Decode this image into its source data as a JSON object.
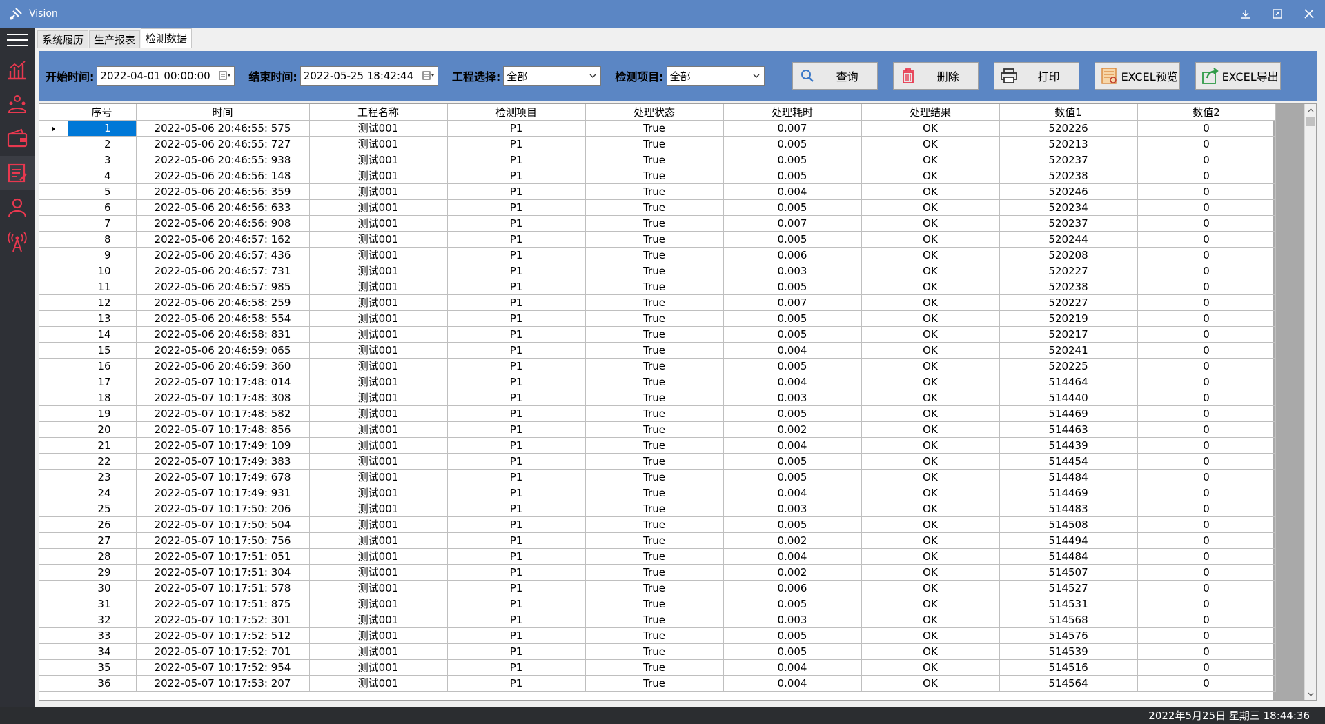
{
  "window": {
    "title": "Vision"
  },
  "tabs": [
    {
      "label": "系统履历",
      "active": false
    },
    {
      "label": "生产报表",
      "active": false
    },
    {
      "label": "检测数据",
      "active": true
    }
  ],
  "nav_icons": [
    "chart-icon",
    "users-icon",
    "wallet-icon",
    "report-icon",
    "person-icon",
    "antenna-icon"
  ],
  "toolbar": {
    "start_label": "开始时间:",
    "start_value": "2022-04-01 00:00:00",
    "end_label": "结束时间:",
    "end_value": "2022-05-25 18:42:44",
    "project_label": "工程选择:",
    "project_value": "全部",
    "item_label": "检测项目:",
    "item_value": "全部",
    "query_label": "查询",
    "delete_label": "删除",
    "print_label": "打印",
    "excel_preview_label": "EXCEL预览",
    "excel_export_label": "EXCEL导出"
  },
  "grid": {
    "columns": [
      "序号",
      "时间",
      "工程名称",
      "检测项目",
      "处理状态",
      "处理耗时",
      "处理结果",
      "数值1",
      "数值2"
    ],
    "rows": [
      [
        "1",
        "2022-05-06 20:46:55: 575",
        "测试001",
        "P1",
        "True",
        "0.007",
        "OK",
        "520226",
        "0"
      ],
      [
        "2",
        "2022-05-06 20:46:55: 727",
        "测试001",
        "P1",
        "True",
        "0.005",
        "OK",
        "520213",
        "0"
      ],
      [
        "3",
        "2022-05-06 20:46:55: 938",
        "测试001",
        "P1",
        "True",
        "0.005",
        "OK",
        "520237",
        "0"
      ],
      [
        "4",
        "2022-05-06 20:46:56: 148",
        "测试001",
        "P1",
        "True",
        "0.005",
        "OK",
        "520238",
        "0"
      ],
      [
        "5",
        "2022-05-06 20:46:56: 359",
        "测试001",
        "P1",
        "True",
        "0.004",
        "OK",
        "520246",
        "0"
      ],
      [
        "6",
        "2022-05-06 20:46:56: 633",
        "测试001",
        "P1",
        "True",
        "0.005",
        "OK",
        "520234",
        "0"
      ],
      [
        "7",
        "2022-05-06 20:46:56: 908",
        "测试001",
        "P1",
        "True",
        "0.007",
        "OK",
        "520237",
        "0"
      ],
      [
        "8",
        "2022-05-06 20:46:57: 162",
        "测试001",
        "P1",
        "True",
        "0.005",
        "OK",
        "520244",
        "0"
      ],
      [
        "9",
        "2022-05-06 20:46:57: 436",
        "测试001",
        "P1",
        "True",
        "0.006",
        "OK",
        "520208",
        "0"
      ],
      [
        "10",
        "2022-05-06 20:46:57: 731",
        "测试001",
        "P1",
        "True",
        "0.003",
        "OK",
        "520227",
        "0"
      ],
      [
        "11",
        "2022-05-06 20:46:57: 985",
        "测试001",
        "P1",
        "True",
        "0.005",
        "OK",
        "520238",
        "0"
      ],
      [
        "12",
        "2022-05-06 20:46:58: 259",
        "测试001",
        "P1",
        "True",
        "0.007",
        "OK",
        "520227",
        "0"
      ],
      [
        "13",
        "2022-05-06 20:46:58: 554",
        "测试001",
        "P1",
        "True",
        "0.005",
        "OK",
        "520219",
        "0"
      ],
      [
        "14",
        "2022-05-06 20:46:58: 831",
        "测试001",
        "P1",
        "True",
        "0.005",
        "OK",
        "520217",
        "0"
      ],
      [
        "15",
        "2022-05-06 20:46:59: 065",
        "测试001",
        "P1",
        "True",
        "0.004",
        "OK",
        "520241",
        "0"
      ],
      [
        "16",
        "2022-05-06 20:46:59: 360",
        "测试001",
        "P1",
        "True",
        "0.005",
        "OK",
        "520225",
        "0"
      ],
      [
        "17",
        "2022-05-07 10:17:48: 014",
        "测试001",
        "P1",
        "True",
        "0.004",
        "OK",
        "514464",
        "0"
      ],
      [
        "18",
        "2022-05-07 10:17:48: 308",
        "测试001",
        "P1",
        "True",
        "0.003",
        "OK",
        "514440",
        "0"
      ],
      [
        "19",
        "2022-05-07 10:17:48: 582",
        "测试001",
        "P1",
        "True",
        "0.005",
        "OK",
        "514469",
        "0"
      ],
      [
        "20",
        "2022-05-07 10:17:48: 856",
        "测试001",
        "P1",
        "True",
        "0.002",
        "OK",
        "514463",
        "0"
      ],
      [
        "21",
        "2022-05-07 10:17:49: 109",
        "测试001",
        "P1",
        "True",
        "0.004",
        "OK",
        "514439",
        "0"
      ],
      [
        "22",
        "2022-05-07 10:17:49: 383",
        "测试001",
        "P1",
        "True",
        "0.005",
        "OK",
        "514454",
        "0"
      ],
      [
        "23",
        "2022-05-07 10:17:49: 678",
        "测试001",
        "P1",
        "True",
        "0.005",
        "OK",
        "514484",
        "0"
      ],
      [
        "24",
        "2022-05-07 10:17:49: 931",
        "测试001",
        "P1",
        "True",
        "0.004",
        "OK",
        "514469",
        "0"
      ],
      [
        "25",
        "2022-05-07 10:17:50: 206",
        "测试001",
        "P1",
        "True",
        "0.003",
        "OK",
        "514483",
        "0"
      ],
      [
        "26",
        "2022-05-07 10:17:50: 504",
        "测试001",
        "P1",
        "True",
        "0.005",
        "OK",
        "514508",
        "0"
      ],
      [
        "27",
        "2022-05-07 10:17:50: 756",
        "测试001",
        "P1",
        "True",
        "0.002",
        "OK",
        "514494",
        "0"
      ],
      [
        "28",
        "2022-05-07 10:17:51: 051",
        "测试001",
        "P1",
        "True",
        "0.004",
        "OK",
        "514484",
        "0"
      ],
      [
        "29",
        "2022-05-07 10:17:51: 304",
        "测试001",
        "P1",
        "True",
        "0.002",
        "OK",
        "514507",
        "0"
      ],
      [
        "30",
        "2022-05-07 10:17:51: 578",
        "测试001",
        "P1",
        "True",
        "0.006",
        "OK",
        "514527",
        "0"
      ],
      [
        "31",
        "2022-05-07 10:17:51: 875",
        "测试001",
        "P1",
        "True",
        "0.005",
        "OK",
        "514531",
        "0"
      ],
      [
        "32",
        "2022-05-07 10:17:52: 301",
        "测试001",
        "P1",
        "True",
        "0.003",
        "OK",
        "514568",
        "0"
      ],
      [
        "33",
        "2022-05-07 10:17:52: 512",
        "测试001",
        "P1",
        "True",
        "0.005",
        "OK",
        "514576",
        "0"
      ],
      [
        "34",
        "2022-05-07 10:17:52: 701",
        "测试001",
        "P1",
        "True",
        "0.005",
        "OK",
        "514539",
        "0"
      ],
      [
        "35",
        "2022-05-07 10:17:52: 954",
        "测试001",
        "P1",
        "True",
        "0.004",
        "OK",
        "514516",
        "0"
      ],
      [
        "36",
        "2022-05-07 10:17:53: 207",
        "测试001",
        "P1",
        "True",
        "0.004",
        "OK",
        "514564",
        "0"
      ]
    ]
  },
  "statusbar": {
    "datetime": "2022年5月25日 星期三   18:44:36"
  },
  "colors": {
    "titlebar": "#5b86c4",
    "toolbar": "#5b86c4",
    "nav_icon": "#e8384f",
    "selection": "#0078d7"
  }
}
